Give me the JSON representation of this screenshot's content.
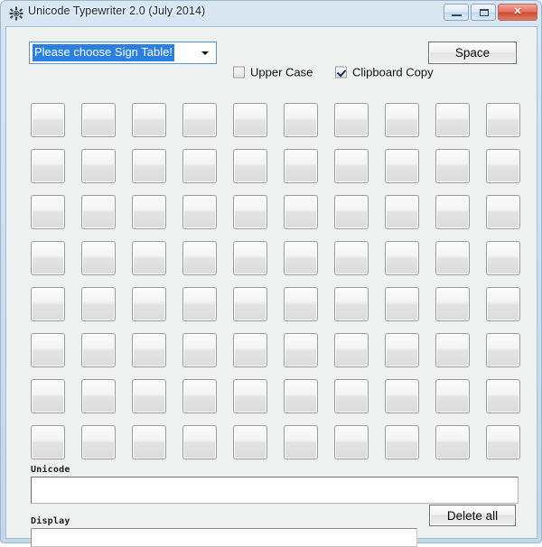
{
  "window": {
    "title": "Unicode Typewriter 2.0 (July 2014)",
    "icon": "app-gear-icon",
    "controls": {
      "minimize_label": "",
      "maximize_label": "",
      "close_label": "✕"
    },
    "accent_selection_color": "#2a7fe0",
    "titlebar_color": "#cfe0ef",
    "client_color": "#eff0f0"
  },
  "toolbar": {
    "sign_table_select": {
      "value": "Please choose Sign Table!",
      "placeholder": "Please choose Sign Table!",
      "options": [
        "Please choose Sign Table!"
      ]
    },
    "upper_case": {
      "label": "Upper Case",
      "checked": false
    },
    "clipboard_copy": {
      "label": "Clipboard Copy",
      "checked": true
    },
    "space_button": {
      "label": "Space"
    }
  },
  "sign_grid": {
    "rows": 8,
    "columns": 10,
    "cells": [
      "",
      "",
      "",
      "",
      "",
      "",
      "",
      "",
      "",
      "",
      "",
      "",
      "",
      "",
      "",
      "",
      "",
      "",
      "",
      "",
      "",
      "",
      "",
      "",
      "",
      "",
      "",
      "",
      "",
      "",
      "",
      "",
      "",
      "",
      "",
      "",
      "",
      "",
      "",
      "",
      "",
      "",
      "",
      "",
      "",
      "",
      "",
      "",
      "",
      "",
      "",
      "",
      "",
      "",
      "",
      "",
      "",
      "",
      "",
      "",
      "",
      "",
      "",
      "",
      "",
      "",
      "",
      "",
      "",
      "",
      "",
      "",
      "",
      "",
      "",
      "",
      "",
      "",
      "",
      ""
    ]
  },
  "output": {
    "unicode": {
      "label": "Unicode",
      "value": "",
      "placeholder": ""
    },
    "display": {
      "label": "Display",
      "value": "",
      "placeholder": ""
    },
    "delete_all_button": {
      "label": "Delete all"
    }
  }
}
